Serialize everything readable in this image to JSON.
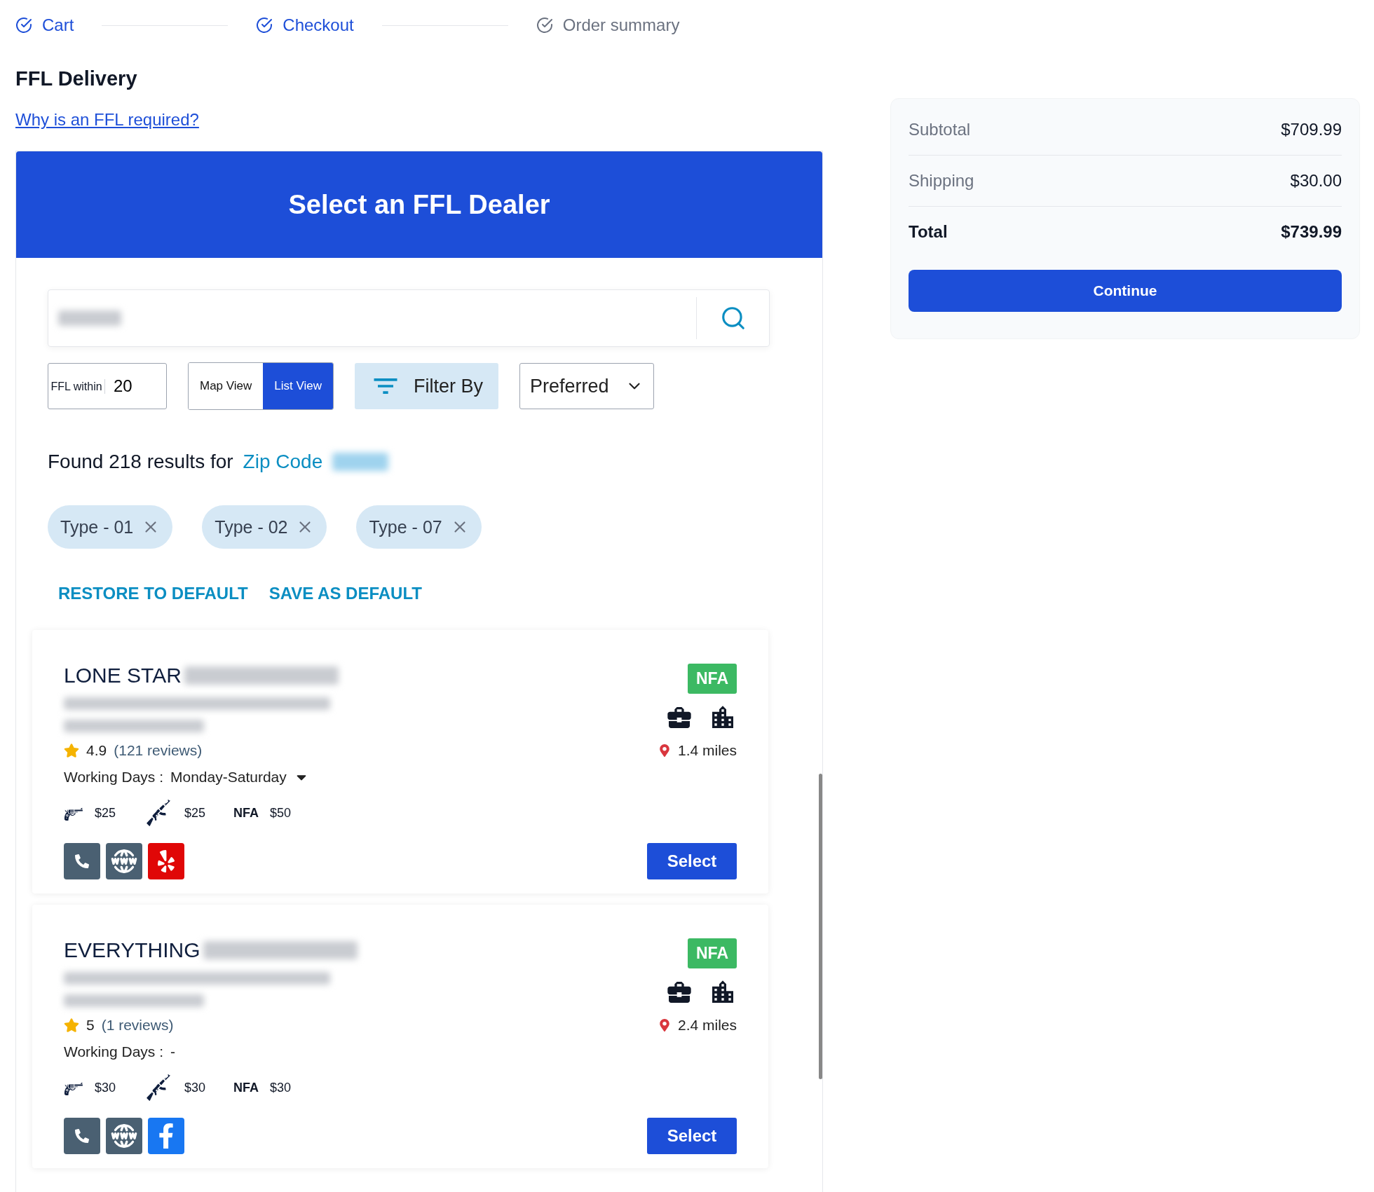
{
  "steps": [
    {
      "label": "Cart",
      "completed": true
    },
    {
      "label": "Checkout",
      "completed": true
    },
    {
      "label": "Order summary",
      "completed": false
    }
  ],
  "title": "FFL Delivery",
  "help_link": "Why is an FFL required?",
  "dealer_panel": {
    "title": "Select an FFL Dealer",
    "radius": {
      "label": "FFL within",
      "value": "20"
    },
    "views": [
      {
        "label": "Map View",
        "selected": false
      },
      {
        "label": "List View",
        "selected": true
      }
    ],
    "filter_button": "Filter By",
    "sort": "Preferred",
    "results": {
      "text": "Found 218 results for",
      "link": "Zip Code"
    },
    "chips": [
      {
        "label": "Type - 01"
      },
      {
        "label": "Type - 02"
      },
      {
        "label": "Type - 07"
      }
    ],
    "actions": [
      "RESTORE TO DEFAULT",
      "SAVE AS DEFAULT"
    ],
    "dealers": [
      {
        "name": "LONE STAR",
        "badge": "NFA",
        "rating": "4.9",
        "reviews": "(121 reviews)",
        "distance": "1.4 miles",
        "working_days_label": "Working Days :",
        "working_days": "Monday-Saturday",
        "days_dropdown": true,
        "fees": [
          {
            "kind": "handgun",
            "price": "$25"
          },
          {
            "kind": "rifle",
            "price": "$25"
          },
          {
            "kind": "nfa",
            "label": "NFA",
            "price": "$50"
          }
        ],
        "links": [
          {
            "kind": "phone"
          },
          {
            "kind": "website"
          },
          {
            "kind": "yelp"
          }
        ],
        "button": "Select"
      },
      {
        "name": "EVERYTHING",
        "badge": "NFA",
        "rating": "5",
        "reviews": "(1 reviews)",
        "distance": "2.4 miles",
        "working_days_label": "Working Days :",
        "working_days": "-",
        "days_dropdown": false,
        "fees": [
          {
            "kind": "handgun",
            "price": "$30"
          },
          {
            "kind": "rifle",
            "price": "$30"
          },
          {
            "kind": "nfa",
            "label": "NFA",
            "price": "$30"
          }
        ],
        "links": [
          {
            "kind": "phone"
          },
          {
            "kind": "website"
          },
          {
            "kind": "facebook"
          }
        ],
        "button": "Select"
      }
    ]
  },
  "summary": {
    "rows": [
      {
        "label": "Subtotal",
        "value": "$709.99",
        "emphasis": false
      },
      {
        "label": "Shipping",
        "value": "$30.00",
        "emphasis": false
      },
      {
        "label": "Total",
        "value": "$739.99",
        "emphasis": true
      }
    ],
    "button": "Continue"
  }
}
